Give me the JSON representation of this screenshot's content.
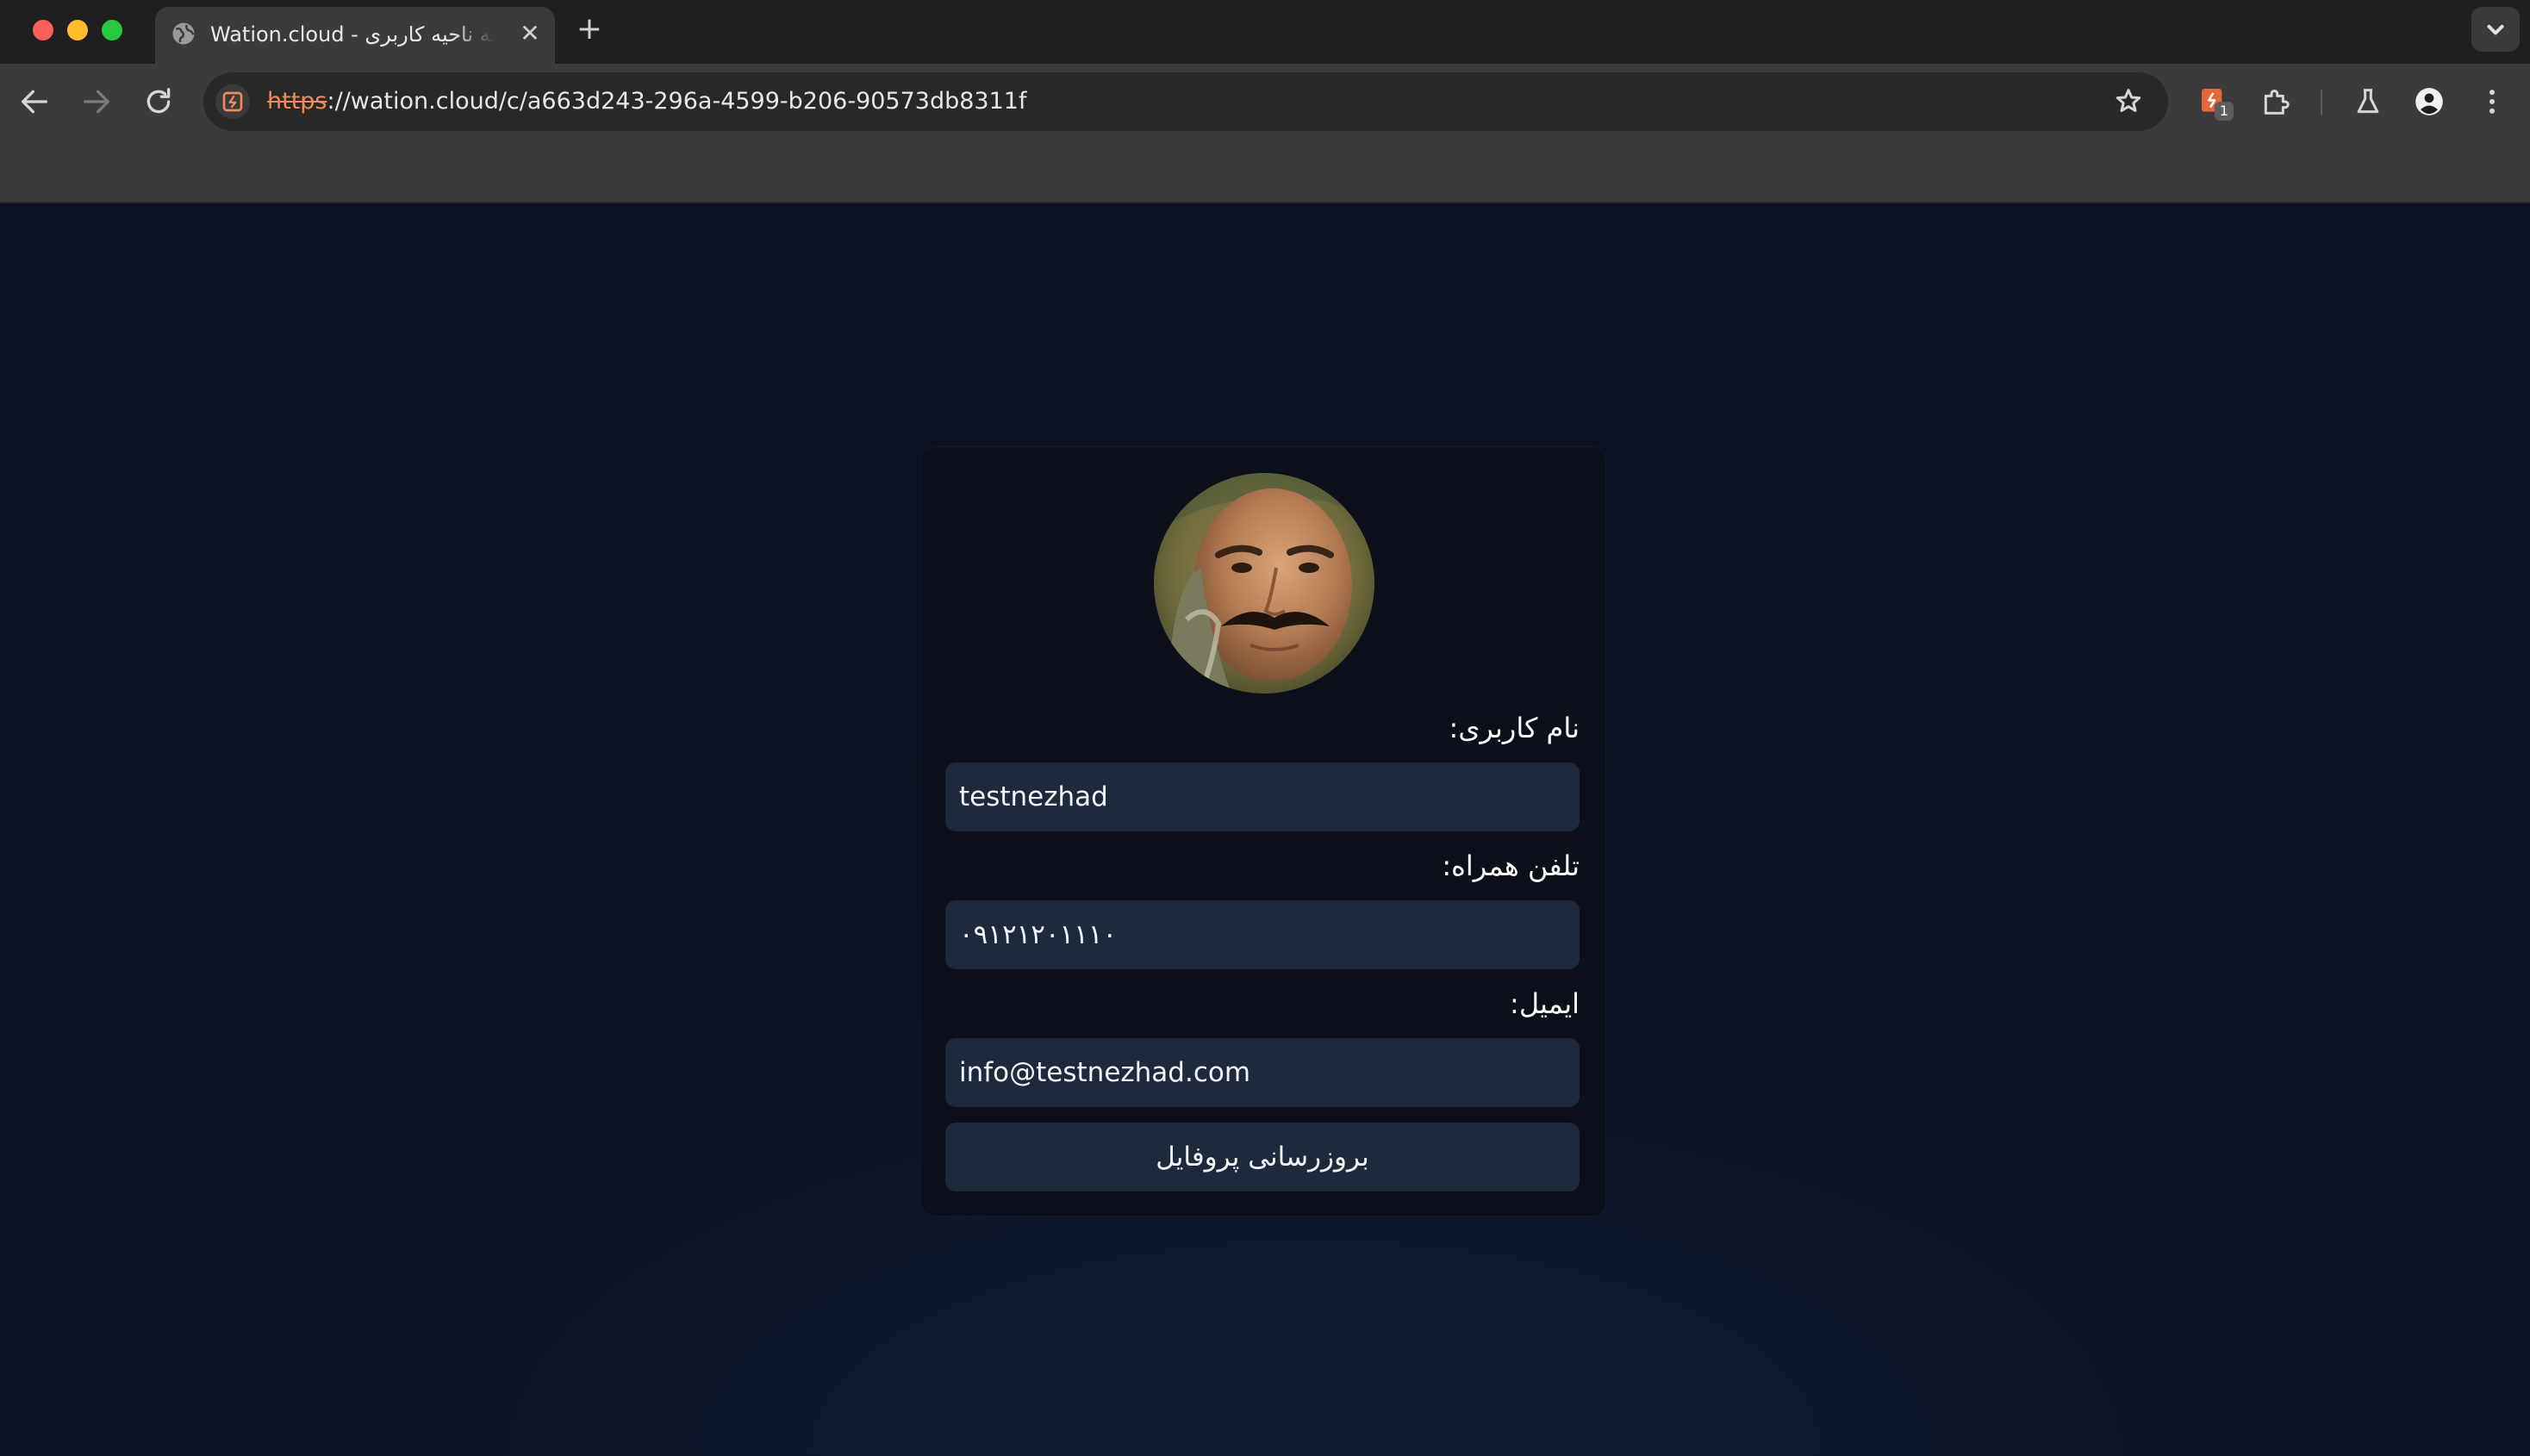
{
  "browser": {
    "tab": {
      "title": "Wation.cloud - ورود به ناحیه کاربری"
    },
    "address_bar": {
      "scheme": "https",
      "rest": "://wation.cloud/c/a663d243-296a-4599-b206-90573db8311f"
    },
    "extension_badge": "1"
  },
  "profile": {
    "username_label": "نام کاربری:",
    "username_value": "testnezhad",
    "phone_label": "تلفن همراه:",
    "phone_value": "۰۹۱۲۱۲۰۱۱۱۰",
    "email_label": "ایمیل:",
    "email_value": "info@testnezhad.com",
    "submit_label": "بروزرسانی پروفایل"
  },
  "colors": {
    "page_bg": "#0d1322",
    "card_bg": "#0b101b",
    "field_bg": "#1e293b",
    "scheme_warning": "#ef8a5c"
  },
  "icons": {
    "back": "arrow-left-icon",
    "forward": "arrow-right-icon",
    "reload": "reload-icon",
    "site_info": "site-info-icon",
    "bookmark": "star-icon",
    "extension": "extension-icon",
    "extensions_menu": "puzzle-icon",
    "labs": "flask-icon",
    "profile": "account-icon",
    "menu": "kebab-menu-icon"
  }
}
